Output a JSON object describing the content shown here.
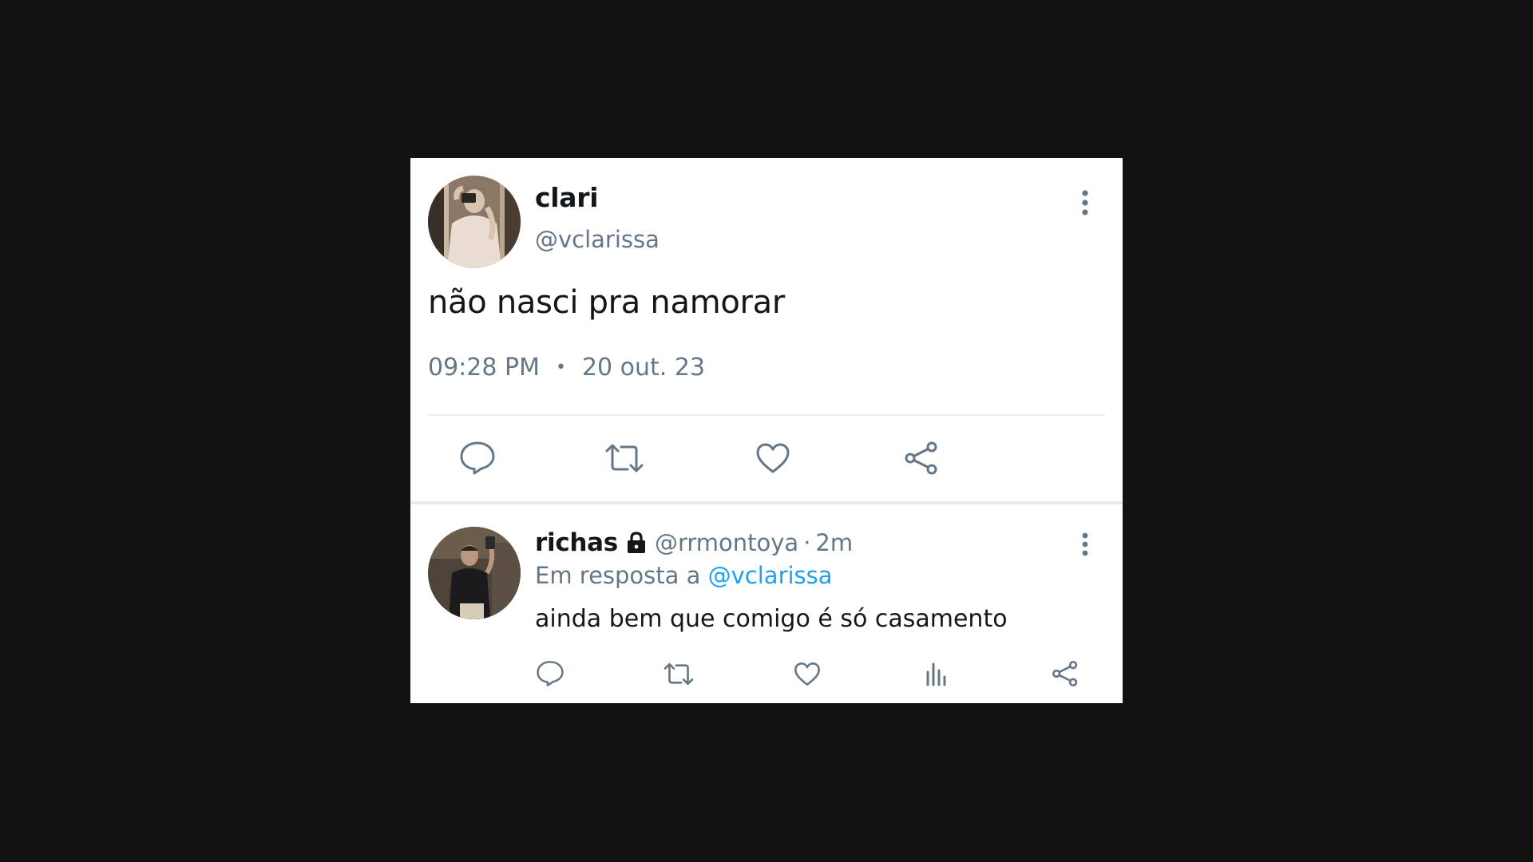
{
  "main_tweet": {
    "display_name": "clari",
    "handle": "@vclarissa",
    "text": "não nasci pra namorar",
    "time": "09:28 PM",
    "separator": "•",
    "date": "20 out. 23"
  },
  "reply": {
    "display_name": "richas",
    "handle": "@rrmontoya",
    "separator": "·",
    "age": "2m",
    "reply_prefix": "Em resposta a",
    "reply_mention": "@vclarissa",
    "text": "ainda bem que comigo é só casamento"
  },
  "icons": {
    "more": "more-vertical-icon",
    "reply": "reply-icon",
    "retweet": "retweet-icon",
    "like": "heart-icon",
    "share": "share-icon",
    "stats": "analytics-icon",
    "lock": "lock-icon"
  },
  "colors": {
    "background": "#121212",
    "card": "#ffffff",
    "text": "#14171a",
    "secondary": "#657786",
    "link": "#1da1f2",
    "divider": "#e6ecf0"
  }
}
